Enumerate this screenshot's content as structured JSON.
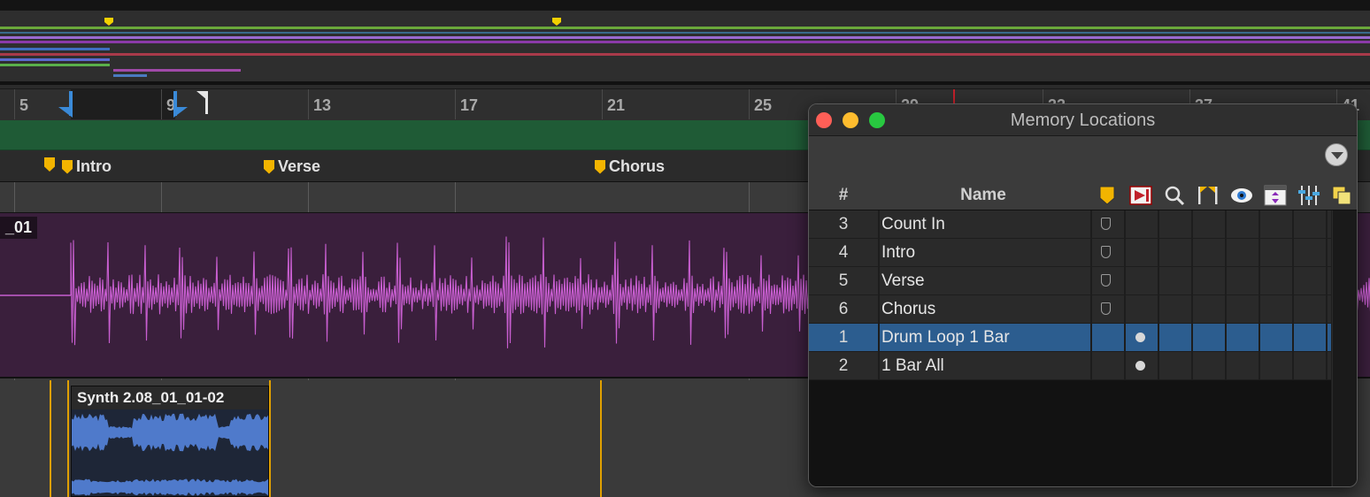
{
  "colors": {
    "marker": "#f2b400",
    "track1_wave": "#c85ed0",
    "track2_wave": "#4f7acb",
    "selection_row": "#2c5d8f",
    "green_strip": "#1f5b36"
  },
  "ruler": {
    "bars": [
      "5",
      "9",
      "13",
      "17",
      "21",
      "25",
      "29",
      "33",
      "37",
      "41"
    ]
  },
  "markers": [
    {
      "name": ""
    },
    {
      "name": "Intro"
    },
    {
      "name": "Verse"
    },
    {
      "name": "Chorus"
    }
  ],
  "tracks": {
    "track1_clip": "_01",
    "track2_clip": "Synth 2.08_01_01-02"
  },
  "memory_locations": {
    "title": "Memory Locations",
    "header": {
      "num": "#",
      "name": "Name"
    },
    "column_icons": [
      "marker-icon",
      "clip-selection-icon",
      "zoom-icon",
      "pre-post-roll-icon",
      "track-show-hide-icon",
      "track-height-icon",
      "group-enables-icon",
      "window-configuration-icon"
    ],
    "rows": [
      {
        "num": "3",
        "name": "Count In",
        "type": "marker",
        "selected": false
      },
      {
        "num": "4",
        "name": "Intro",
        "type": "marker",
        "selected": false
      },
      {
        "num": "5",
        "name": "Verse",
        "type": "marker",
        "selected": false
      },
      {
        "num": "6",
        "name": "Chorus",
        "type": "marker",
        "selected": false
      },
      {
        "num": "1",
        "name": "Drum Loop 1 Bar",
        "type": "selection",
        "selected": true
      },
      {
        "num": "2",
        "name": "1 Bar All",
        "type": "selection",
        "selected": false
      }
    ]
  }
}
